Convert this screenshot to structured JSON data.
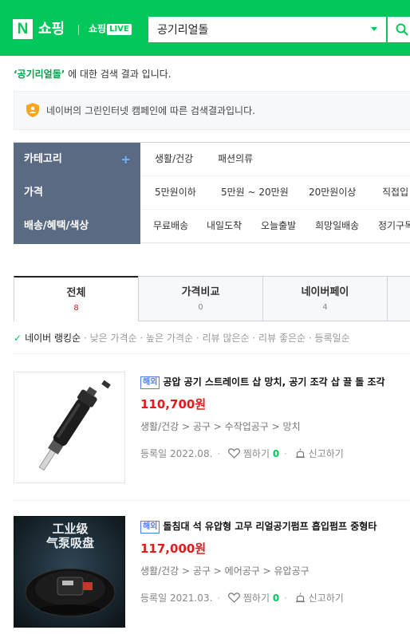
{
  "header": {
    "logo_n": "N",
    "logo_shopping": "쇼핑",
    "live_prefix": "쇼핑",
    "live_badge": "LIVE",
    "search_value": "공기리얼돌"
  },
  "result_notice": {
    "keyword": "‘공기리얼돌’",
    "text": " 에 대한 검색 결과 입니다."
  },
  "green_notice": "네이버의 그린인터넷 캠페인에 따른 검색결과입니다.",
  "filters": {
    "category": {
      "label": "카테고리",
      "plus": "+",
      "options": [
        "생활/건강",
        "패션의류"
      ]
    },
    "price": {
      "label": "가격",
      "options": [
        "5만원이하",
        "5만원 ~ 20만원",
        "20만원이상",
        "직접입"
      ]
    },
    "delivery": {
      "label": "배송/혜택/색상",
      "options": [
        "무료배송",
        "내일도착",
        "오늘출발",
        "희망일배송",
        "정기구독"
      ]
    }
  },
  "tabs": [
    {
      "label": "전체",
      "count": "8"
    },
    {
      "label": "가격비교",
      "count": "0"
    },
    {
      "label": "네이버페이",
      "count": "4"
    }
  ],
  "sort": {
    "check": "✓",
    "active": "네이버 랭킹순",
    "options": [
      "낮은 가격순",
      "높은 가격순",
      "리뷰 많은순",
      "리뷰 좋은순",
      "등록일순"
    ]
  },
  "products": [
    {
      "badge": "해외",
      "title": "공압 공기 스트레이트 삽 망치, 공기 조각 삽 끌 돌 조각",
      "price": "110,700원",
      "category": "생활/건강 > 공구 > 수작업공구 > 망치",
      "reg_label": "등록일",
      "reg_date": "2022.08.",
      "zzim_label": "찜하기",
      "zzim_count": "0",
      "report_label": "신고하기"
    },
    {
      "badge": "해외",
      "title": "돌침대 석 유압형 고무 리얼공기펌프 흡입펌프 중형타",
      "price": "117,000원",
      "category": "생활/건강 > 공구 > 에어공구 > 유압공구",
      "reg_label": "등록일",
      "reg_date": "2021.03.",
      "zzim_label": "찜하기",
      "zzim_count": "0",
      "report_label": "신고하기",
      "image_text_line1": "工业级",
      "image_text_line2": "气泵吸盘"
    }
  ],
  "colors": {
    "brand_green": "#03c75a",
    "filter_head": "#5a6a82",
    "price_red": "#e21c1c",
    "badge_blue": "#4d7ef0"
  }
}
